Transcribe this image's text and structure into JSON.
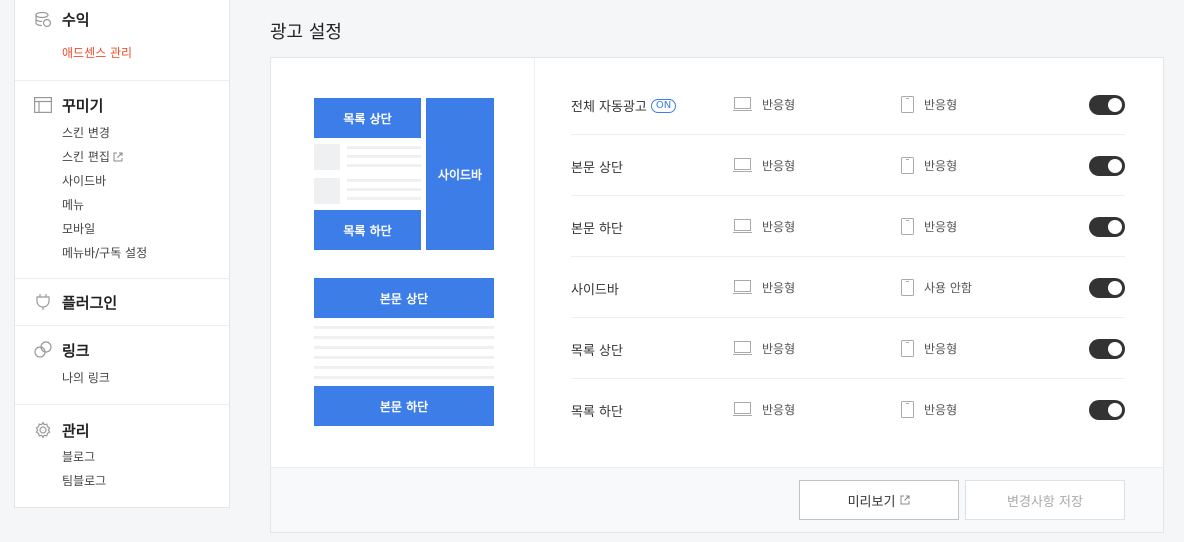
{
  "sidebar": {
    "revenue": {
      "title": "수익",
      "items": [
        "애드센스 관리"
      ]
    },
    "decorate": {
      "title": "꾸미기",
      "items": [
        "스킨 변경",
        "스킨 편집",
        "사이드바",
        "메뉴",
        "모바일",
        "메뉴바/구독 설정"
      ]
    },
    "plugin": {
      "title": "플러그인"
    },
    "link": {
      "title": "링크",
      "items": [
        "나의 링크"
      ]
    },
    "manage": {
      "title": "관리",
      "items": [
        "블로그",
        "팀블로그"
      ]
    }
  },
  "page_title": "광고 설정",
  "preview": {
    "list_top": "목록 상단",
    "list_bottom": "목록 하단",
    "sidebar": "사이드바",
    "body_top": "본문 상단",
    "body_bottom": "본문 하단"
  },
  "ad_rows": [
    {
      "name": "전체 자동광고",
      "badge": "ON",
      "pc": "반응형",
      "mobile": "반응형",
      "enabled": true
    },
    {
      "name": "본문 상단",
      "pc": "반응형",
      "mobile": "반응형",
      "enabled": true
    },
    {
      "name": "본문 하단",
      "pc": "반응형",
      "mobile": "반응형",
      "enabled": true
    },
    {
      "name": "사이드바",
      "pc": "반응형",
      "mobile": "사용 안함",
      "enabled": true
    },
    {
      "name": "목록 상단",
      "pc": "반응형",
      "mobile": "반응형",
      "enabled": true
    },
    {
      "name": "목록 하단",
      "pc": "반응형",
      "mobile": "반응형",
      "enabled": true
    }
  ],
  "buttons": {
    "preview": "미리보기",
    "save": "변경사항 저장"
  },
  "colors": {
    "accent": "#3d7de8",
    "active_menu": "#ef4e2b",
    "toggle_on": "#333333"
  },
  "icons": {
    "revenue": "coins-icon",
    "decorate": "layout-icon",
    "plugin": "plug-icon",
    "link": "link-icon",
    "manage": "gear-icon",
    "external": "external-link-icon",
    "pc": "monitor-icon",
    "mobile": "phone-icon"
  }
}
